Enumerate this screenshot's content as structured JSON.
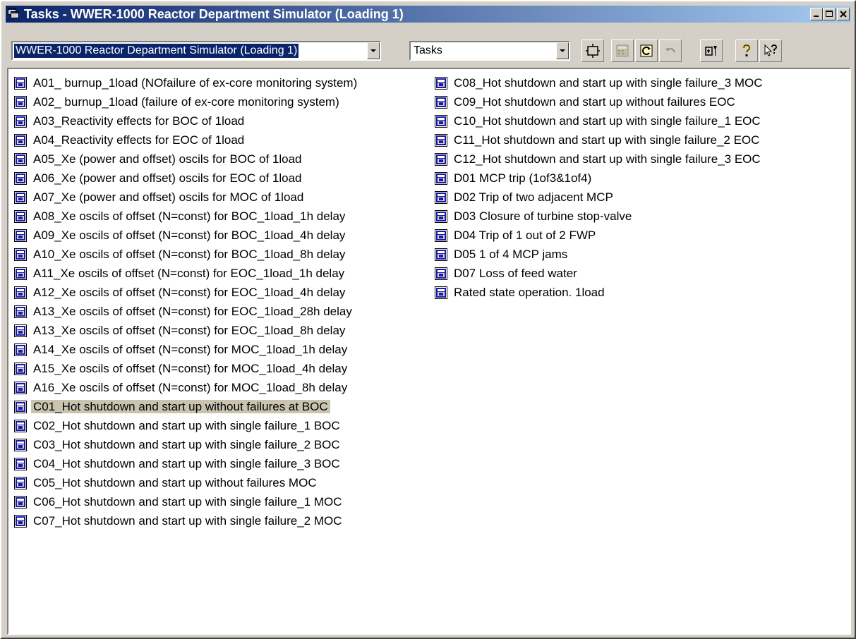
{
  "window": {
    "title": "Tasks - WWER-1000 Reactor Department Simulator (Loading 1)"
  },
  "toolbar": {
    "simulator_select": "WWER-1000 Reactor Department Simulator (Loading 1)",
    "mode_select": "Tasks"
  },
  "tasks": {
    "selected_index": 17,
    "column1": [
      "A01_ burnup_1load (NOfailure of ex-core monitoring system)",
      "A02_ burnup_1load (failure of ex-core monitoring system)",
      "A03_Reactivity effects for BOC of 1load",
      "A04_Reactivity effects for EOC of 1load",
      "A05_Xe (power and offset) oscils for BOC of 1load",
      "A06_Xe (power and offset) oscils for EOC of 1load",
      "A07_Xe (power and offset) oscils for MOC of 1load",
      "A08_Xe oscils of offset (N=const) for BOC_1load_1h delay",
      "A09_Xe oscils of offset (N=const) for BOC_1load_4h delay",
      "A10_Xe oscils of offset (N=const) for BOC_1load_8h delay",
      "A11_Xe oscils of offset (N=const) for EOC_1load_1h delay",
      "A12_Xe oscils of offset (N=const) for EOC_1load_4h delay",
      "A13_Xe oscils of offset (N=const) for EOC_1load_28h delay",
      "A13_Xe oscils of offset (N=const) for EOC_1load_8h delay",
      "A14_Xe oscils of offset (N=const) for MOC_1load_1h delay",
      "A15_Xe oscils of offset (N=const) for MOC_1load_4h delay",
      "A16_Xe oscils of offset (N=const) for MOC_1load_8h delay",
      "C01_Hot shutdown and start  up without  failures at BOC",
      "C02_Hot shutdown and start up with single failure_1 BOC",
      "C03_Hot shutdown and start up with single failure_2 BOC",
      "C04_Hot shutdown and start up with single failure_3 BOC",
      "C05_Hot shutdown and start up without failures MOC",
      "C06_Hot shutdown and start up with single failure_1 MOC",
      "C07_Hot shutdown and start up with single failure_2 MOC"
    ],
    "column2": [
      "C08_Hot shutdown and start up with single failure_3 MOC",
      "C09_Hot shutdown and start up without failures EOC",
      "C10_Hot shutdown and start up with single failure_1 EOC",
      "C11_Hot shutdown and start up with single failure_2 EOC",
      "C12_Hot shutdown and start up with single failure_3 EOC",
      "D01 MCP trip (1of3&1of4)",
      "D02 Trip of two adjacent MCP",
      "D03 Closure of turbine stop-valve",
      "D04 Trip of 1 out of  2 FWP",
      "D05 1 of 4 MCP jams",
      "D07 Loss of  feed water",
      "Rated state operation. 1load"
    ]
  },
  "colors": {
    "title_start": "#0a246a",
    "title_end": "#a6caf0",
    "face": "#d4d0c8",
    "selected_highlight": "#c8c4b0",
    "task_icon_blue": "#1a1aa8"
  },
  "icons": {
    "app": "app-window-icon",
    "task": "task-item-icon",
    "toolbar": [
      "fit-frame-icon",
      "calculator-icon",
      "refresh-icon",
      "undo-icon",
      "tools-icon",
      "help-icon",
      "context-help-icon"
    ]
  }
}
